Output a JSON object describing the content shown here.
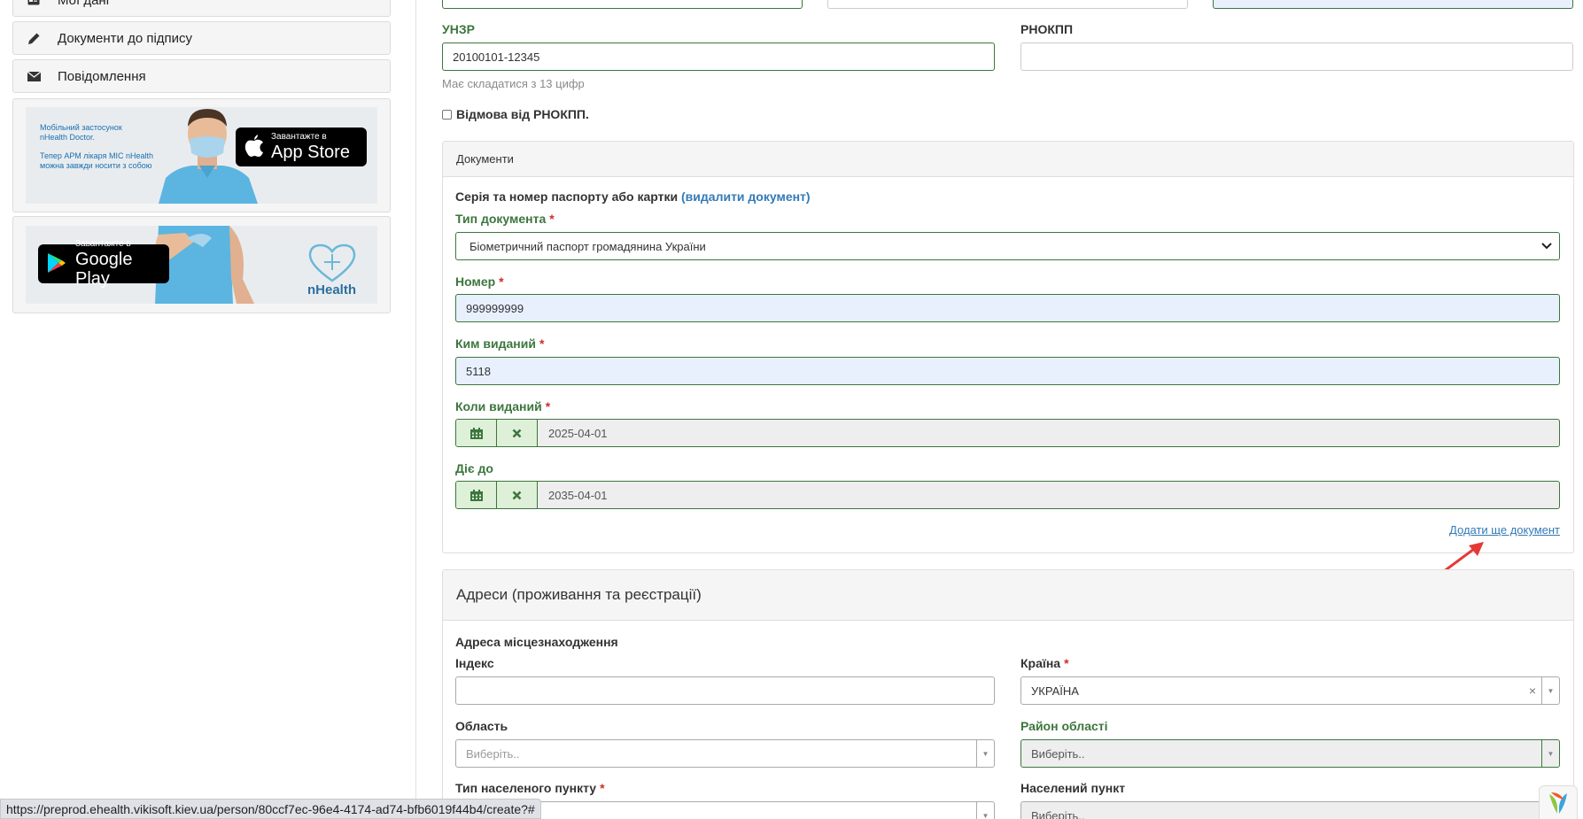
{
  "sidebar": {
    "my_data": "Мої дані",
    "documents_to_sign": "Документи до підпису",
    "messages": "Повідомлення",
    "banner1": {
      "line1": "Мобільний застосунок",
      "line2": "nHealth Doctor.",
      "line3": "Тепер АРМ лікаря МІС nHealth",
      "line4": "можна завжди носити з собою",
      "store_small": "Завантажте в",
      "store_big": "App Store"
    },
    "banner2": {
      "store_small": "Завантажте в",
      "store_big": "Google Play",
      "logo": "nHealth"
    }
  },
  "form": {
    "unzr_label": "УНЗР",
    "unzr_value": "20100101-12345",
    "unzr_hint": "Має складатися з 13 цифр",
    "rnokpp_label": "РНОКПП",
    "rnokpp_value": "",
    "refuse_rnokpp": "Відмова від РНОКПП."
  },
  "documents": {
    "panel_title": "Документи",
    "doc_heading": "Серія та номер паспорту або картки",
    "delete_link": "(видалити документ)",
    "doc_type_label": "Тип документа",
    "doc_type_value": "Біометричний паспорт громадянина України",
    "number_label": "Номер",
    "number_value": "999999999",
    "issued_by_label": "Ким виданий",
    "issued_by_value": "5118",
    "issued_date_label": "Коли виданий",
    "issued_date_value": "2025-04-01",
    "valid_until_label": "Діє до",
    "valid_until_value": "2035-04-01",
    "add_more_link": "Додати ще документ"
  },
  "address": {
    "panel_title": "Адреси (проживання та реєстрації)",
    "location_heading": "Адреса місцезнаходження",
    "index_label": "Індекс",
    "index_value": "",
    "country_label": "Країна",
    "country_value": "УКРАЇНА",
    "region_label": "Область",
    "region_placeholder": "Виберіть..",
    "district_label": "Район області",
    "district_placeholder": "Виберіть..",
    "settlement_type_label": "Тип населеного пункту",
    "settlement_label": "Населений пункт",
    "settlement_placeholder": "Виберіть.."
  },
  "required_mark": "*",
  "status_url": "https://preprod.ehealth.vikisoft.kiev.ua/person/80ccf7ec-96e4-4174-ad74-bfb6019f44b4/create?#",
  "colors": {
    "success_green": "#3c763d",
    "link_blue": "#337ab7",
    "required_red": "#c9302c",
    "autofill_blue": "#e8f0fe"
  }
}
